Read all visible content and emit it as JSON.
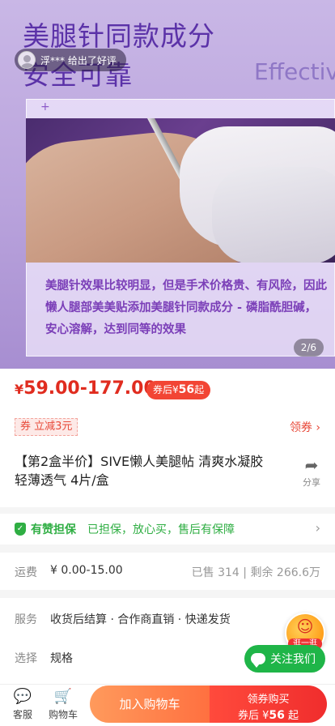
{
  "hero": {
    "title_line1": "美腿针同款成分",
    "title_line2": "安全可靠",
    "effective": "Effective",
    "plus": "+",
    "description": "美腿针效果比较明显，但是手术价格贵、有风险，因此懒人腿部美美贴添加美腿针同款成分 - 磷脂酰胆碱，安心溶解，达到同等的效果",
    "page_indicator": "2/6"
  },
  "toast": {
    "text": "浮*** 给出了好评"
  },
  "price": {
    "currency": "¥",
    "range": "59.00-177.00",
    "coupon_prefix": "券后",
    "coupon_currency": "¥",
    "coupon_value": "56",
    "coupon_suffix": "起"
  },
  "coupon": {
    "tag": "券  立减3元",
    "link": "领券",
    "chevron": "›"
  },
  "product": {
    "title": "【第2盒半价】SIVE懒人美腿帖 清爽水凝胶 轻薄透气 4片/盒",
    "share_label": "分享",
    "share_icon": "share-arrow"
  },
  "guarantee": {
    "name": "有赞担保",
    "text": "已担保，放心买，售后有保障",
    "chevron": "›"
  },
  "shipping": {
    "label": "运费",
    "fee": "¥ 0.00-15.00",
    "stats": "已售 314 | 剩余 266.6万"
  },
  "service": {
    "label": "服务",
    "text": "收货后结算 · 合作商直销 · 快递发货"
  },
  "select": {
    "label": "选择",
    "text": "规格"
  },
  "floating": {
    "bag_label": "逛一逛",
    "follow_label": "关注我们"
  },
  "bottom_bar": {
    "customer_service": "客服",
    "cart": "购物车",
    "add_to_cart": "加入购物车",
    "buy_line1": "领券购买",
    "buy_line2_prefix": "券后 ¥",
    "buy_line2_value": "56",
    "buy_line2_suffix": "起"
  },
  "colors": {
    "price_red": "#e02c1f",
    "guarantee_green": "#2fae43",
    "hero_purple": "#5b32a8"
  }
}
